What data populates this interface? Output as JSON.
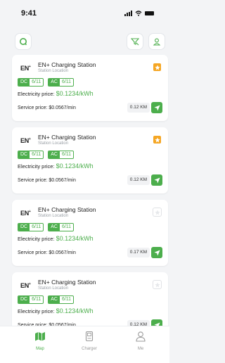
{
  "status_bar": {
    "time": "9:41"
  },
  "cards": [
    {
      "logo": "EN",
      "name": "EN+ Charging Station",
      "location": "Station Location",
      "dc_label": "DC",
      "dc_count": "6/11",
      "ac_label": "AC",
      "ac_count": "6/11",
      "electricity_label": "Electricity price:",
      "electricity_price": "$0.1234/kWh",
      "service": "Service price: $0.0567/min",
      "distance": "0.12 KM",
      "favorite": true
    },
    {
      "logo": "EN",
      "name": "EN+ Charging Station",
      "location": "Station Location",
      "dc_label": "DC",
      "dc_count": "6/11",
      "ac_label": "AC",
      "ac_count": "6/11",
      "electricity_label": "Electricity price:",
      "electricity_price": "$0.1234/kWh",
      "service": "Service price: $0.0567/min",
      "distance": "0.12 KM",
      "favorite": true
    },
    {
      "logo": "EN",
      "name": "EN+ Charging Station",
      "location": "Station Location",
      "dc_label": "DC",
      "dc_count": "6/11",
      "ac_label": "AC",
      "ac_count": "6/11",
      "electricity_label": "Electricity price:",
      "electricity_price": "$0.1234/kWh",
      "service": "Service price: $0.0567/min",
      "distance": "0.17 KM",
      "favorite": false
    },
    {
      "logo": "EN",
      "name": "EN+ Charging Station",
      "location": "Station Location",
      "dc_label": "DC",
      "dc_count": "6/11",
      "ac_label": "AC",
      "ac_count": "6/11",
      "electricity_label": "Electricity price:",
      "electricity_price": "$0.1234/kWh",
      "service": "Service price: $0.0567/min",
      "distance": "0.12 KM",
      "favorite": false
    }
  ],
  "tabs": [
    {
      "label": "Map",
      "icon": "map-icon",
      "active": true
    },
    {
      "label": "Charger",
      "icon": "charger-icon",
      "active": false
    },
    {
      "label": "Me",
      "icon": "person-icon",
      "active": false
    }
  ],
  "colors": {
    "accent": "#4cae4c",
    "favorite": "#f5a623",
    "background": "#f3f4f6"
  }
}
